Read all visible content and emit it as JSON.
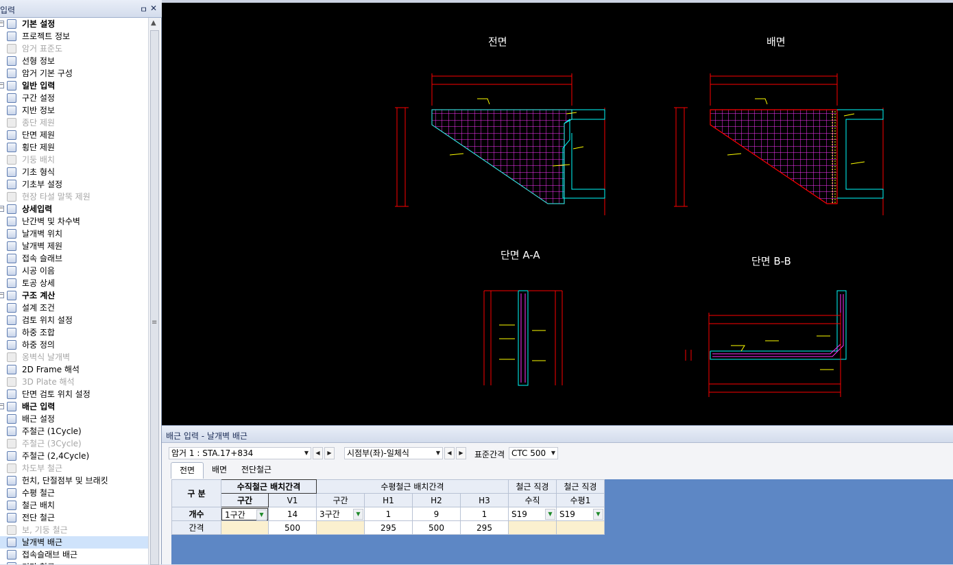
{
  "left_panel": {
    "title": "입력",
    "pin": "ㅁ",
    "close": "✕",
    "tree": [
      {
        "label": "기본 설정",
        "group": true,
        "icon": "pencil-icon"
      },
      {
        "label": "프로젝트 정보",
        "icon": "document-icon"
      },
      {
        "label": "암거 표준도",
        "disabled": true,
        "icon": "db-icon"
      },
      {
        "label": "선형 정보",
        "icon": "curve-icon"
      },
      {
        "label": "암거 기본 구성",
        "icon": "frame-icon"
      },
      {
        "label": "일반 입력",
        "group": true,
        "icon": "box-icon"
      },
      {
        "label": "구간 설정",
        "icon": "arch-icon"
      },
      {
        "label": "지반 정보",
        "icon": "pile-icon"
      },
      {
        "label": "종단 제원",
        "disabled": true,
        "icon": "profile-icon"
      },
      {
        "label": "단면 제원",
        "icon": "section-icon"
      },
      {
        "label": "횡단 제원",
        "icon": "cross-section-icon"
      },
      {
        "label": "기둥 배치",
        "disabled": true,
        "icon": "column-icon"
      },
      {
        "label": "기초 형식",
        "icon": "footing-icon"
      },
      {
        "label": "기초부 설정",
        "icon": "grid-icon"
      },
      {
        "label": "현장 타설 말뚝 제원",
        "disabled": true,
        "icon": "pile-cast-icon"
      },
      {
        "label": "상세입력",
        "group": true,
        "icon": "detail-icon"
      },
      {
        "label": "난간벽 및 차수벽",
        "icon": "wall-icon"
      },
      {
        "label": "날개벽 위치",
        "icon": "wing-position-icon"
      },
      {
        "label": "날개벽 제원",
        "icon": "wing-icon"
      },
      {
        "label": "접속 슬래브",
        "icon": "slab-icon"
      },
      {
        "label": "시공 이음",
        "icon": "joint-icon"
      },
      {
        "label": "토공 상세",
        "icon": "earthwork-icon"
      },
      {
        "label": "구조 계산",
        "group": true,
        "icon": "calculator-icon"
      },
      {
        "label": "설계 조건",
        "icon": "condition-icon"
      },
      {
        "label": "검토 위치 설정",
        "icon": "position-icon"
      },
      {
        "label": "하중 조합",
        "icon": "combination-icon"
      },
      {
        "label": "하중 정의",
        "icon": "load-icon"
      },
      {
        "label": "옹벽식 날개벽",
        "disabled": true,
        "icon": "retaining-wall-icon"
      },
      {
        "label": "2D Frame 해석",
        "icon": "frame-2d-icon"
      },
      {
        "label": "3D Plate 해석",
        "disabled": true,
        "icon": "plate-3d-icon"
      },
      {
        "label": "단면 검토 위치 설정",
        "icon": "section-check-icon"
      },
      {
        "label": "배근 입력",
        "group": true,
        "icon": "rebar-icon"
      },
      {
        "label": "배근 설정",
        "icon": "rebar-setting-icon"
      },
      {
        "label": "주철근 (1Cycle)",
        "icon": "main-rebar-icon"
      },
      {
        "label": "주철근 (3Cycle)",
        "disabled": true,
        "icon": "main-rebar-icon"
      },
      {
        "label": "주철근 (2,4Cycle)",
        "icon": "main-rebar-icon"
      },
      {
        "label": "차도부 철근",
        "disabled": true,
        "icon": "road-rebar-icon"
      },
      {
        "label": "헌치, 단절점부 및 브래킷",
        "icon": "haunch-icon"
      },
      {
        "label": "수평 철근",
        "icon": "horizontal-rebar-icon"
      },
      {
        "label": "철근 배치",
        "icon": "rebar-layout-icon"
      },
      {
        "label": "전단 철근",
        "icon": "shear-rebar-icon"
      },
      {
        "label": "보, 기둥 철근",
        "disabled": true,
        "icon": "beam-rebar-icon"
      },
      {
        "label": "날개벽 배근",
        "selected": true,
        "icon": "wing-rebar-icon"
      },
      {
        "label": "접속슬래브 배근",
        "icon": "slab-rebar-icon"
      },
      {
        "label": "기타 철근",
        "icon": "etc-rebar-icon"
      }
    ]
  },
  "cad": {
    "titles": {
      "front": "전면",
      "back": "배면",
      "section_a": "단면 A-A",
      "section_b": "단면 B-B"
    }
  },
  "bottom": {
    "title": "배근 입력 - 날개벽 배근",
    "culvert_select": "암거 1 : STA.17+834",
    "position_select": "시점부(좌)-일체식",
    "std_spacing_label": "표준간격",
    "std_spacing_value": "CTC 500",
    "tabs": [
      "전면",
      "배면",
      "전단철근"
    ],
    "grid": {
      "corner": "구 분",
      "group_vertical": "수직철근 배치간격",
      "group_horizontal": "수평철근 배치간격",
      "group_dia1": "철근 직경",
      "group_dia2": "철근 직경",
      "col_section_v": "구간",
      "col_v1": "V1",
      "col_section_h": "구간",
      "col_h1": "H1",
      "col_h2": "H2",
      "col_h3": "H3",
      "col_vertical": "수직",
      "col_horizontal1": "수평1",
      "row_count": "개수",
      "row_spacing": "간격",
      "count": {
        "section_v": "1구간",
        "v1": "14",
        "section_h": "3구간",
        "h1": "1",
        "h2": "9",
        "h3": "1",
        "dia_v": "S19",
        "dia_h": "S19"
      },
      "spacing": {
        "v1": "500",
        "h1": "295",
        "h2": "500",
        "h3": "295"
      }
    }
  },
  "colors": {
    "cad_bg": "#000000",
    "rebar": "#ff33ff",
    "outline_red": "#ff0000",
    "outline_cyan": "#00ffff",
    "grid_bg": "#5d87c5"
  }
}
